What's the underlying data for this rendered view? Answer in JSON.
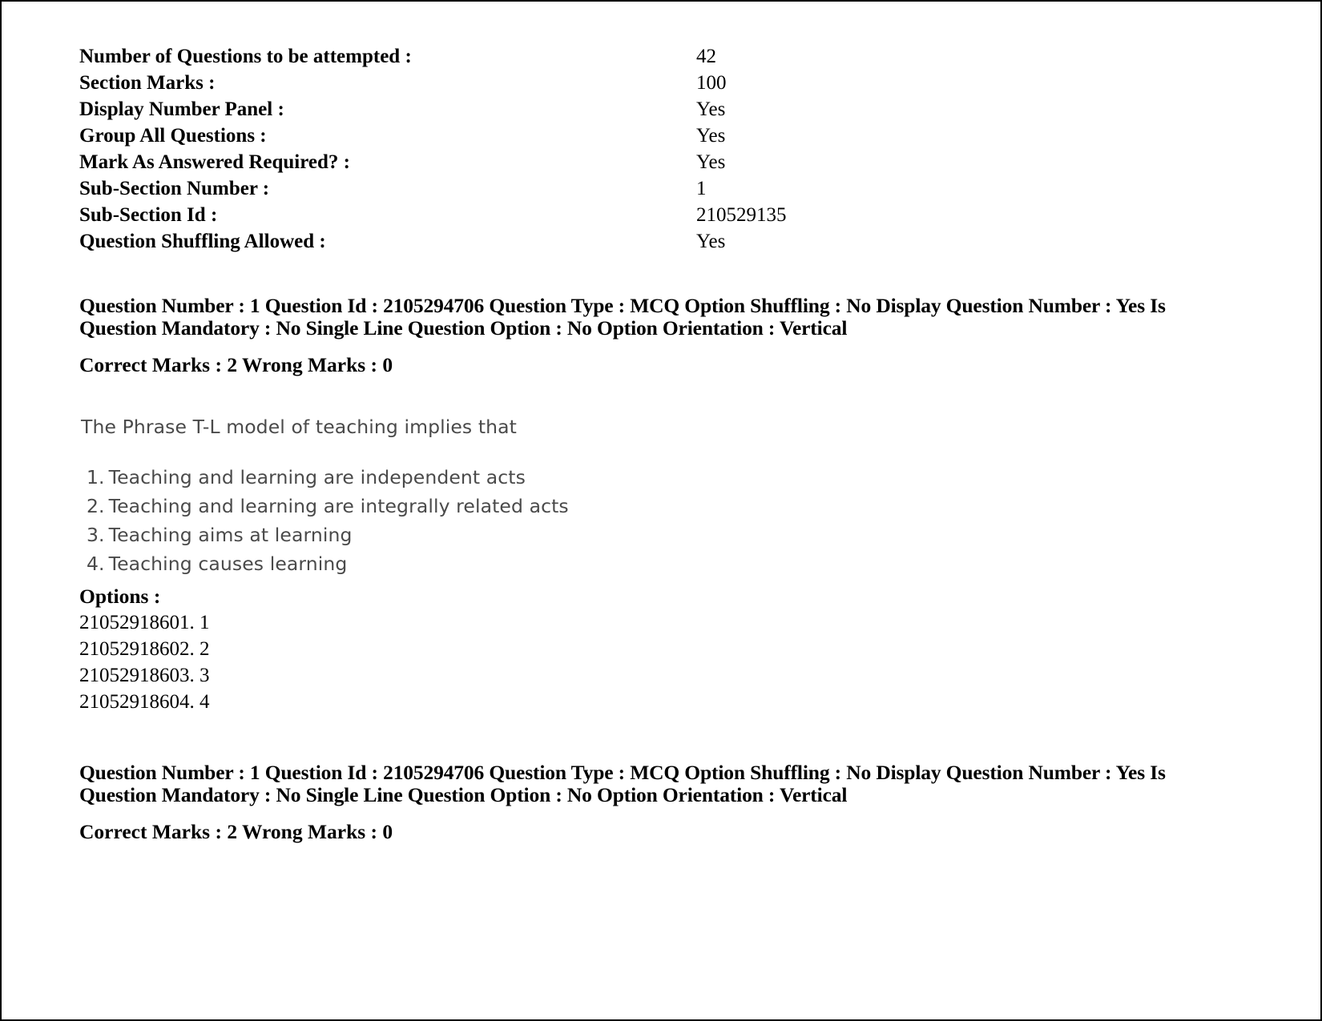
{
  "section_info": {
    "rows": [
      {
        "label": "Number of Questions to be attempted :",
        "value": "42"
      },
      {
        "label": "Section Marks :",
        "value": "100"
      },
      {
        "label": "Display Number Panel :",
        "value": "Yes"
      },
      {
        "label": "Group All Questions :",
        "value": "Yes"
      },
      {
        "label": "Mark As Answered Required? :",
        "value": "Yes"
      },
      {
        "label": "Sub-Section Number :",
        "value": "1"
      },
      {
        "label": "Sub-Section Id :",
        "value": "210529135"
      },
      {
        "label": "Question Shuffling Allowed :",
        "value": "Yes"
      }
    ]
  },
  "question_meta_top": {
    "line1": "Question Number : 1 Question Id : 2105294706 Question Type : MCQ Option Shuffling : No Display Question Number : Yes Is Question Mandatory : No Single Line Question Option : No Option Orientation : Vertical",
    "marks": "Correct Marks : 2 Wrong Marks : 0"
  },
  "question_body": {
    "stem": "The Phrase T-L model of teaching implies that",
    "statements": [
      {
        "number": "1.",
        "text": "Teaching and learning are independent acts"
      },
      {
        "number": "2.",
        "text": "Teaching and learning are integrally related acts"
      },
      {
        "number": "3.",
        "text": "Teaching aims at learning"
      },
      {
        "number": "4.",
        "text": "Teaching causes learning"
      }
    ]
  },
  "options": {
    "label": "Options :",
    "items": [
      "21052918601. 1",
      "21052918602. 2",
      "21052918603. 3",
      "21052918604. 4"
    ]
  },
  "question_meta_bottom": {
    "line1": "Question Number : 1 Question Id : 2105294706 Question Type : MCQ Option Shuffling : No Display Question Number : Yes Is Question Mandatory : No Single Line Question Option : No Option Orientation : Vertical",
    "marks": "Correct Marks : 2 Wrong Marks : 0"
  },
  "colors": {
    "page_background": "#ffffff",
    "body_text": "#000000",
    "embedded_question_text": "#4a4a4a",
    "page_border": "#000000"
  }
}
